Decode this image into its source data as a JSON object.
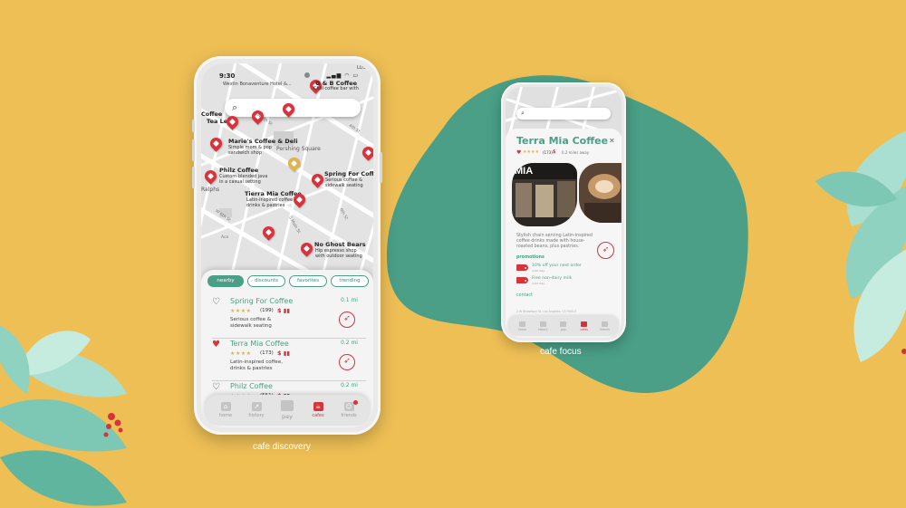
{
  "discovery": {
    "caption": "cafe discovery",
    "status": {
      "time": "9:30",
      "indicators": "▂▄▆ ◠ ▭"
    },
    "search": {
      "icon": "search-icon"
    },
    "map_pins": [
      {
        "name": "G & B Coffee",
        "desc": [
          "Chill coffee bar with",
          "espresso & teas"
        ]
      },
      {
        "name": "Marie's Coffee & Deli",
        "desc": [
          "Simple mom & pop",
          "sandwich shop"
        ]
      },
      {
        "name": "Philz Coffee",
        "desc": [
          "Custom-blended java",
          "in a casual setting"
        ]
      },
      {
        "name": "Spring For Coffee",
        "desc": [
          "Serious coffee &",
          "sidewalk seating"
        ]
      },
      {
        "name": "Tierra Mia Coffee",
        "desc": [
          "Latin-inspired coffee",
          "drinks & pastries"
        ]
      },
      {
        "name": "No Ghost Bears",
        "desc": [
          "Hip espresso shop",
          "with outdoor seating"
        ]
      },
      {
        "name": "Coffee",
        "desc": []
      },
      {
        "name": "Tea Leaf",
        "desc": []
      }
    ],
    "map_labels": {
      "top_left": "Westin Bonaventure Hotel &...",
      "pershing": "Pershing Square",
      "ralphs": "Ralphs",
      "ace": "Ace",
      "s_main": "S Main St",
      "w6": "W 6th St",
      "w5": "W 5th St",
      "w4": "W 4th St",
      "s4": "4th St",
      "s6": "6th St",
      "hill": "S Hill St",
      "ipo": "LOS"
    },
    "filters": [
      {
        "label": "nearby",
        "active": true
      },
      {
        "label": "discounts",
        "active": false
      },
      {
        "label": "favorites",
        "active": false
      },
      {
        "label": "trending",
        "active": false
      }
    ],
    "cafes": [
      {
        "name": "Spring For Coffee",
        "favorited": false,
        "stars": "★★★★",
        "reviews": "(199)",
        "price": "$",
        "price_accent": "▮▮",
        "desc": [
          "Serious coffee &",
          "sidewalk seating"
        ],
        "distance": "0.1 mi"
      },
      {
        "name": "Terra Mia Coffee",
        "favorited": true,
        "stars": "★★★★",
        "reviews": "(173)",
        "price": "$",
        "price_accent": "▮▮",
        "desc": [
          "Latin-inspired coffee,",
          "drinks & pastries"
        ],
        "distance": "0.2 mi"
      },
      {
        "name": "Philz Coffee",
        "favorited": false,
        "stars": "★★★★",
        "reviews": "(551)",
        "price": "$",
        "price_accent": "▮▮",
        "desc": [],
        "distance": "0.2 mi"
      }
    ],
    "tabs": [
      {
        "label": "home",
        "icon": "home-icon"
      },
      {
        "label": "history",
        "icon": "history-icon"
      },
      {
        "label": "pay",
        "icon": "pay-icon"
      },
      {
        "label": "cafes",
        "icon": "cafes-icon",
        "active": true
      },
      {
        "label": "friends",
        "icon": "friends-icon",
        "badge": true
      }
    ]
  },
  "focus": {
    "caption": "cafe focus",
    "cafe": {
      "name": "Terra Mia Coffee",
      "close": "✕",
      "stars": "★★★★",
      "reviews": "(173)",
      "price": "$",
      "distance": "0.2 miles away",
      "photo_sign": "MIA",
      "blurb": "Stylish chain serving Latin-inspired coffee drinks made with house-roasted beans, plus pastries.",
      "promotions_heading": "promotions",
      "promotions": [
        {
          "title": "10% off your next order",
          "sub": "until may"
        },
        {
          "title": "Free non-dairy milk",
          "sub": "until may"
        }
      ],
      "contact_heading": "contact",
      "address": "2 W Broadway St, Los Angeles, CA 90013"
    },
    "tabs": [
      {
        "label": "home"
      },
      {
        "label": "history"
      },
      {
        "label": "pay"
      },
      {
        "label": "cafes",
        "active": true
      },
      {
        "label": "friends"
      }
    ]
  },
  "colors": {
    "background": "#eebf55",
    "teal": "#4a9f86",
    "red": "#d6333b",
    "star": "#e2b34d"
  }
}
